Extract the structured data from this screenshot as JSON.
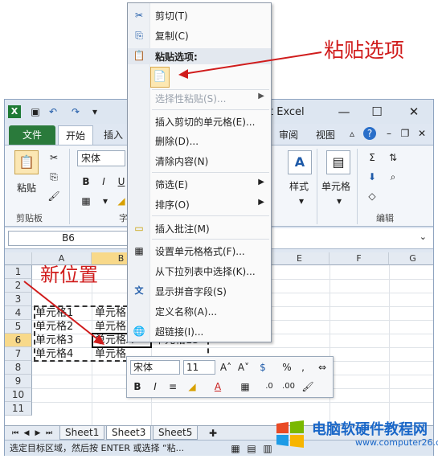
{
  "window": {
    "title": "t Excel",
    "min_icon": "minimize-icon",
    "max_icon": "maximize-icon",
    "close_icon": "close-icon"
  },
  "ribbon": {
    "tabs": [
      "文件",
      "开始",
      "插入",
      "审阅",
      "视图"
    ],
    "paste_label": "粘贴",
    "font_name": "宋体",
    "clipboard_label": "剪贴板",
    "styles_label": "样式",
    "cells_label": "单元格",
    "editing_label": "编辑",
    "font_group_partial": "字"
  },
  "formula": {
    "namebox": "B6"
  },
  "grid": {
    "columns": [
      "A",
      "B",
      "E",
      "F",
      "G"
    ],
    "rows": [
      "1",
      "2",
      "3",
      "4",
      "5",
      "6",
      "7",
      "8",
      "9",
      "10",
      "11"
    ],
    "cells": {
      "a4": "单元格1",
      "b4": "单元格",
      "a5": "单元格2",
      "b5": "单元格",
      "a6": "单元格3",
      "b6": "单元格A",
      "c6": "单元格13",
      "a7": "单元格4",
      "b7": "单元格"
    }
  },
  "sheets": [
    "Sheet1",
    "Sheet3",
    "Sheet5"
  ],
  "status": {
    "text": "选定目标区域，然后按 ENTER 或选择 “粘..."
  },
  "context_menu": {
    "cut": "剪切(T)",
    "copy": "复制(C)",
    "paste_options": "粘贴选项:",
    "paste_special": "选择性粘贴(S)...",
    "insert_cut": "插入剪切的单元格(E)...",
    "delete": "删除(D)...",
    "clear": "清除内容(N)",
    "filter": "筛选(E)",
    "sort": "排序(O)",
    "insert_comment": "插入批注(M)",
    "format_cells": "设置单元格格式(F)...",
    "pick_list": "从下拉列表中选择(K)...",
    "phonetic": "显示拼音字段(S)",
    "define_name": "定义名称(A)...",
    "hyperlink": "超链接(I)..."
  },
  "mini_toolbar": {
    "font": "宋体",
    "size": "11",
    "percent": "%",
    "comma": ","
  },
  "annotations": {
    "paste_options": "粘贴选项",
    "new_position": "新位置"
  },
  "watermark": {
    "brand": "电脑软硬件教程网",
    "url": "www.computer26.com"
  },
  "colors": {
    "annotation": "#d01c1c",
    "file_tab": "#2a7a3b",
    "watermark": "#1a67c8"
  }
}
